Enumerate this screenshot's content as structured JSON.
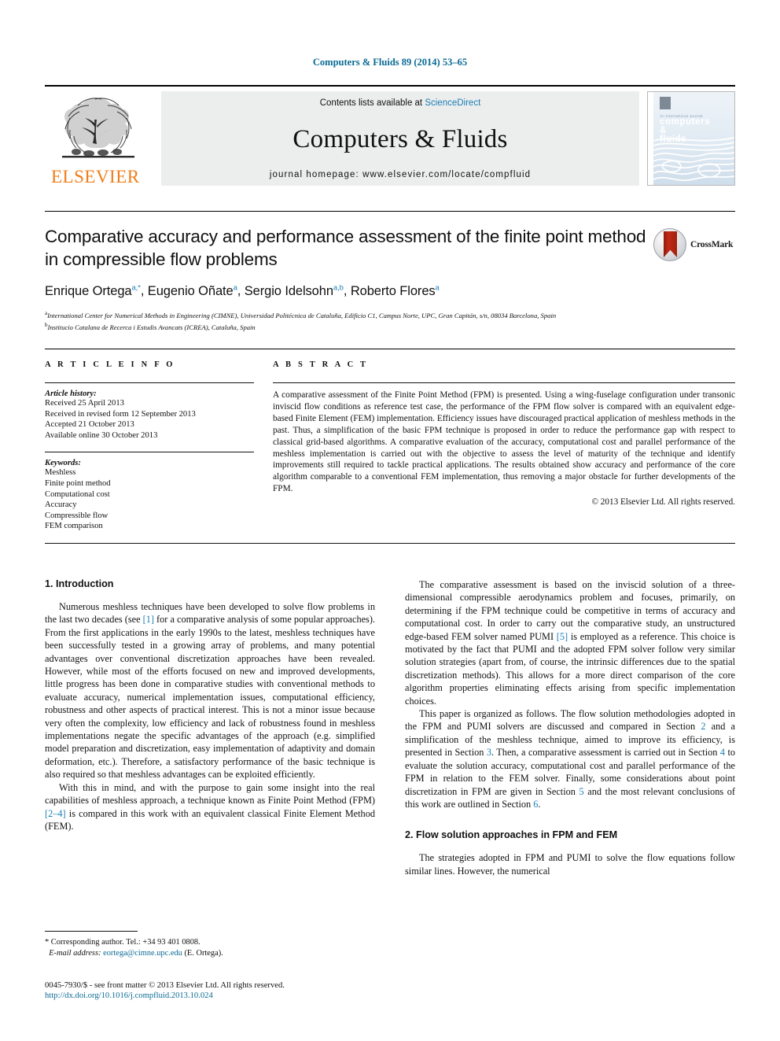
{
  "running_head": "Computers & Fluids 89 (2014) 53–65",
  "masthead": {
    "publisher_name": "ELSEVIER",
    "contents_prefix": "Contents lists available at ",
    "contents_link": "ScienceDirect",
    "journal_title": "Computers & Fluids",
    "homepage": "journal homepage: www.elsevier.com/locate/compfluid",
    "cover": {
      "sub": "An International Journal",
      "line1": "computers",
      "line2": "&",
      "line3": "fluids"
    }
  },
  "article": {
    "title": "Comparative accuracy and performance assessment of the finite point method in compressible flow problems",
    "authors": [
      {
        "name": "Enrique Ortega",
        "marks": "a,*"
      },
      {
        "name": "Eugenio Oñate",
        "marks": "a"
      },
      {
        "name": "Sergio Idelsohn",
        "marks": "a,b"
      },
      {
        "name": "Roberto Flores",
        "marks": "a"
      }
    ],
    "affiliations": [
      {
        "mark": "a",
        "text": "International Center for Numerical Methods in Engineering (CIMNE), Universidad Politécnica de Cataluña, Edificio C1, Campus Norte, UPC, Gran Capitán, s/n, 08034 Barcelona, Spain"
      },
      {
        "mark": "b",
        "text": "Institucio Catalana de Recerca i Estudis Avancats (ICREA), Cataluña, Spain"
      }
    ],
    "crossmark_label": "CrossMark"
  },
  "info": {
    "heading": "A R T I C L E   I N F O",
    "history_label": "Article history:",
    "history": [
      "Received 25 April 2013",
      "Received in revised form 12 September 2013",
      "Accepted 21 October 2013",
      "Available online 30 October 2013"
    ],
    "keywords_label": "Keywords:",
    "keywords": [
      "Meshless",
      "Finite point method",
      "Computational cost",
      "Accuracy",
      "Compressible flow",
      "FEM comparison"
    ]
  },
  "abstract": {
    "heading": "A B S T R A C T",
    "text": "A comparative assessment of the Finite Point Method (FPM) is presented. Using a wing-fuselage configuration under transonic inviscid flow conditions as reference test case, the performance of the FPM flow solver is compared with an equivalent edge-based Finite Element (FEM) implementation. Efficiency issues have discouraged practical application of meshless methods in the past. Thus, a simplification of the basic FPM technique is proposed in order to reduce the performance gap with respect to classical grid-based algorithms. A comparative evaluation of the accuracy, computational cost and parallel performance of the meshless implementation is carried out with the objective to assess the level of maturity of the technique and identify improvements still required to tackle practical applications. The results obtained show accuracy and performance of the core algorithm comparable to a conventional FEM implementation, thus removing a major obstacle for further developments of the FPM.",
    "copyright": "© 2013 Elsevier Ltd. All rights reserved."
  },
  "body": {
    "section1_heading": "1. Introduction",
    "section2_heading": "2. Flow solution approaches in FPM and FEM",
    "p1_a": "Numerous meshless techniques have been developed to solve flow problems in the last two decades (see ",
    "p1_ref": "[1]",
    "p1_b": " for a comparative analysis of some popular approaches). From the first applications in the early 1990s to the latest, meshless techniques have been successfully tested in a growing array of problems, and many potential advantages over conventional discretization approaches have been revealed. However, while most of the efforts focused on new and improved developments, little progress has been done in comparative studies with conventional methods to evaluate accuracy, numerical implementation issues, computational efficiency, robustness and other aspects of practical interest. This is not a minor issue because very often the complexity, low efficiency and lack of robustness found in meshless implementations negate the specific advantages of the approach (e.g. simplified model preparation and discretization, easy implementation of adaptivity and domain deformation, etc.). Therefore, a satisfactory performance of the basic technique is also required so that meshless advantages can be exploited efficiently.",
    "p2_a": "With this in mind, and with the purpose to gain some insight into the real capabilities of meshless approach, a technique known as Finite Point Method (FPM) ",
    "p2_ref": "[2–4]",
    "p2_b": " is compared in this work with an equivalent classical Finite Element Method (FEM).",
    "p3_a": "The comparative assessment is based on the inviscid solution of a three-dimensional compressible aerodynamics problem and focuses, primarily, on determining if the FPM technique could be competitive in terms of accuracy and computational cost. In order to carry out the comparative study, an unstructured edge-based FEM solver named PUMI ",
    "p3_ref": "[5]",
    "p3_b": " is employed as a reference. This choice is motivated by the fact that PUMI and the adopted FPM solver follow very similar solution strategies (apart from, of course, the intrinsic differences due to the spatial discretization methods). This allows for a more direct comparison of the core algorithm properties eliminating effects arising from specific implementation choices.",
    "p4_a": "This paper is organized as follows. The flow solution methodologies adopted in the FPM and PUMI solvers are discussed and compared in Section ",
    "p4_r1": "2",
    "p4_b": " and a simplification of the meshless technique, aimed to improve its efficiency, is presented in Section ",
    "p4_r2": "3",
    "p4_c": ". Then, a comparative assessment is carried out in Section ",
    "p4_r3": "4",
    "p4_d": " to evaluate the solution accuracy, computational cost and parallel performance of the FPM in relation to the FEM solver. Finally, some considerations about point discretization in FPM are given in Section ",
    "p4_r4": "5",
    "p4_e": " and the most relevant conclusions of this work are outlined in Section ",
    "p4_r5": "6",
    "p4_f": ".",
    "p5": "The strategies adopted in FPM and PUMI to solve the flow equations follow similar lines. However, the numerical"
  },
  "footnote": {
    "corresponding": "* Corresponding author. Tel.: +34 93 401 0808.",
    "email_label": "E-mail address:",
    "email": "eortega@cimne.upc.edu",
    "email_suffix": "(E. Ortega)."
  },
  "footer": {
    "issn_line": "0045-7930/$ - see front matter © 2013 Elsevier Ltd. All rights reserved.",
    "doi": "http://dx.doi.org/10.1016/j.compfluid.2013.10.024"
  },
  "colors": {
    "link": "#1a7fb5",
    "link_dark": "#0a6a94",
    "elsevier_orange": "#ef7d1a",
    "band_gray": "#eceded"
  }
}
